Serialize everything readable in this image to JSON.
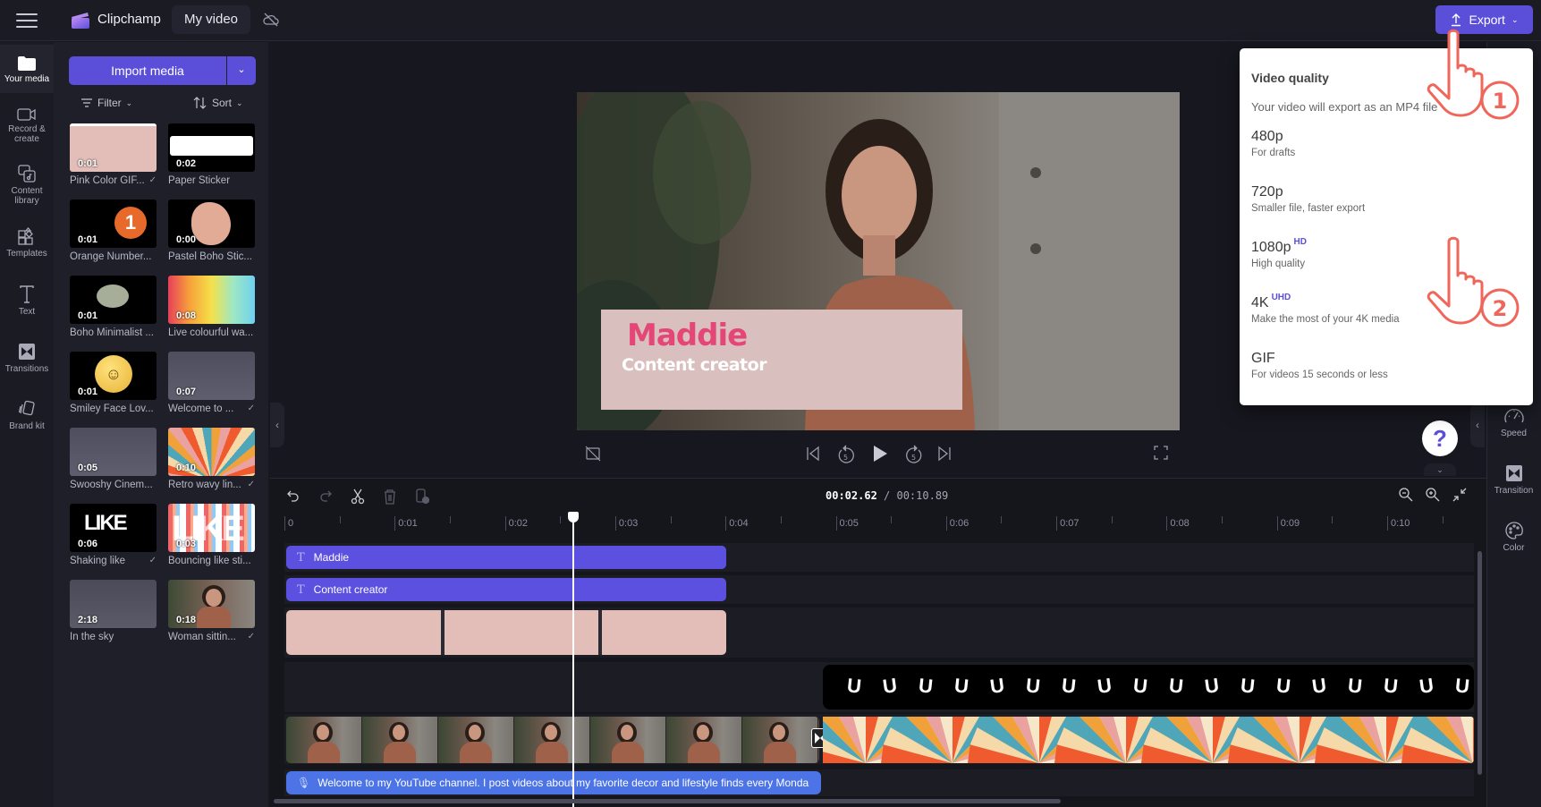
{
  "app": {
    "brand": "Clipchamp",
    "project_name": "My video",
    "export_label": "Export",
    "accent": "#5b4fd9"
  },
  "left_nav": [
    {
      "label": "Your media",
      "icon": "folder-icon",
      "active": true
    },
    {
      "label": "Record & create",
      "icon": "camera-icon"
    },
    {
      "label": "Content library",
      "icon": "content-library-icon"
    },
    {
      "label": "Templates",
      "icon": "templates-icon"
    },
    {
      "label": "Text",
      "icon": "text-icon"
    },
    {
      "label": "Transitions",
      "icon": "transitions-icon"
    },
    {
      "label": "Brand kit",
      "icon": "brand-kit-icon"
    }
  ],
  "media_panel": {
    "import_label": "Import media",
    "filter_label": "Filter",
    "sort_label": "Sort",
    "items": [
      {
        "label": "Pink Color GIF...",
        "duration": "0:01",
        "checked": true
      },
      {
        "label": "Paper Sticker",
        "duration": "0:02",
        "checked": false
      },
      {
        "label": "Orange Number...",
        "duration": "0:01",
        "checked": false
      },
      {
        "label": "Pastel Boho Stic...",
        "duration": "0:00",
        "checked": false
      },
      {
        "label": "Boho Minimalist ...",
        "duration": "0:01",
        "checked": false
      },
      {
        "label": "Live colourful wa...",
        "duration": "0:08",
        "checked": false
      },
      {
        "label": "Smiley Face Lov...",
        "duration": "0:01",
        "checked": false
      },
      {
        "label": "Welcome to ...",
        "duration": "0:07",
        "checked": true
      },
      {
        "label": "Swooshy Cinem...",
        "duration": "0:05",
        "checked": false
      },
      {
        "label": "Retro wavy lin...",
        "duration": "0:10",
        "checked": true
      },
      {
        "label": "Shaking like",
        "duration": "0:06",
        "checked": true
      },
      {
        "label": "Bouncing like sti...",
        "duration": "0:03",
        "checked": false
      },
      {
        "label": "In the sky",
        "duration": "2:18",
        "checked": false
      },
      {
        "label": "Woman sittin...",
        "duration": "0:18",
        "checked": true
      }
    ]
  },
  "preview": {
    "title_text": "Maddie",
    "subtitle_text": "Content creator"
  },
  "timeline": {
    "current_time": "00:02.62",
    "total_time": "/ 00:10.89",
    "ruler": [
      "0",
      "0:01",
      "0:02",
      "0:03",
      "0:04",
      "0:05",
      "0:06",
      "0:07",
      "0:08",
      "0:09",
      "0:10"
    ],
    "playhead_seconds": 2.62,
    "text_clips": [
      {
        "label": "Maddie"
      },
      {
        "label": "Content creator"
      }
    ],
    "caption_clip": "Welcome to my YouTube channel. I post videos about my favorite decor and lifestyle finds every Monda"
  },
  "right_panel": [
    {
      "label": "Speed",
      "icon": "speed-icon"
    },
    {
      "label": "Transition",
      "icon": "transition-icon"
    },
    {
      "label": "Color",
      "icon": "color-palette-icon"
    }
  ],
  "export_menu": {
    "heading": "Video quality",
    "subheading": "Your video will export as an MP4 file",
    "options": [
      {
        "name": "480p",
        "badge": "",
        "desc": "For drafts"
      },
      {
        "name": "720p",
        "badge": "",
        "desc": "Smaller file, faster export"
      },
      {
        "name": "1080p",
        "badge": "HD",
        "desc": "High quality"
      },
      {
        "name": "4K",
        "badge": "UHD",
        "desc": "Make the most of your 4K media"
      },
      {
        "name": "GIF",
        "badge": "",
        "desc": "For videos 15 seconds or less"
      }
    ]
  },
  "annotations": [
    "1",
    "2"
  ]
}
